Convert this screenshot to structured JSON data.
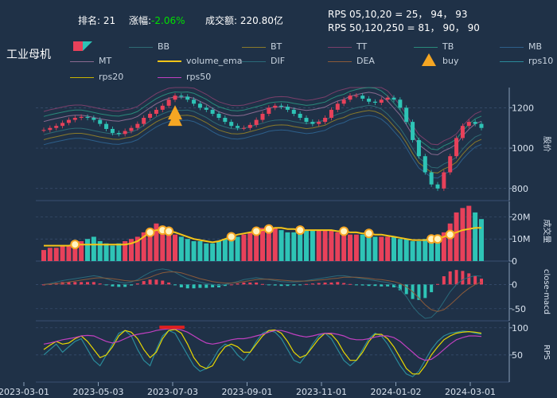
{
  "header": {
    "rank_label": "排名:",
    "rank_value": "21",
    "change_label": "涨幅:",
    "change_value": "-2.06%",
    "turnover_label": "成交额:",
    "turnover_value": "220.80亿",
    "rps_line1": "RPS 05,10,20 = 25， 94， 93",
    "rps_line2": "RPS 50,120,250 = 81， 90， 90",
    "stock_name": "工业母机"
  },
  "legend": [
    {
      "name": "BB",
      "color": "#2f6b74"
    },
    {
      "name": "BT",
      "color": "#8a7a2a"
    },
    {
      "name": "TT",
      "color": "#7a3f6a"
    },
    {
      "name": "TB",
      "color": "#2a8a7a"
    },
    {
      "name": "MB",
      "color": "#2d5f8a"
    },
    {
      "name": "MT",
      "color": "#8a6a90"
    },
    {
      "name": "volume_ema",
      "color": "#f5c518"
    },
    {
      "name": "DIF",
      "color": "#2a6a7a"
    },
    {
      "name": "DEA",
      "color": "#8a5a3a"
    },
    {
      "name": "buy",
      "color": "#f5a623"
    },
    {
      "name": "rps10",
      "color": "#2a8a9a"
    },
    {
      "name": "rps20",
      "color": "#c8b400"
    },
    {
      "name": "rps50",
      "color": "#c040c0"
    }
  ],
  "colors": {
    "up": "#e8415a",
    "down": "#2ec4b6",
    "background": "#1f3147",
    "grid": "#3a5070"
  },
  "chart_data": {
    "type": "candlestick",
    "x_ticks": [
      "2023-03-01",
      "2023-05-03",
      "2023-07-03",
      "2023-09-01",
      "2023-11-01",
      "2024-01-02",
      "2024-03-01"
    ],
    "panels": [
      {
        "id": "price",
        "ylabel": "股价",
        "yticks": [
          800,
          1000,
          1200
        ],
        "ylim": [
          740,
          1300
        ],
        "close": [
          1090,
          1100,
          1110,
          1125,
          1140,
          1150,
          1155,
          1150,
          1140,
          1120,
          1095,
          1075,
          1070,
          1085,
          1100,
          1120,
          1150,
          1170,
          1190,
          1210,
          1240,
          1260,
          1255,
          1240,
          1220,
          1200,
          1190,
          1170,
          1150,
          1130,
          1110,
          1100,
          1100,
          1115,
          1140,
          1170,
          1200,
          1210,
          1205,
          1190,
          1170,
          1150,
          1130,
          1120,
          1130,
          1150,
          1190,
          1220,
          1240,
          1260,
          1260,
          1245,
          1230,
          1225,
          1240,
          1250,
          1240,
          1200,
          1130,
          1040,
          960,
          880,
          820,
          800,
          880,
          960,
          1050,
          1110,
          1130,
          1120,
          1100
        ],
        "buy_markers": [
          21
        ]
      },
      {
        "id": "volume",
        "ylabel": "成交量",
        "yticks": [
          "0",
          "10M",
          "20M"
        ],
        "ylim": [
          0,
          27
        ],
        "values": [
          5,
          6,
          6,
          7,
          7,
          8,
          9,
          10,
          11,
          9,
          8,
          7,
          8,
          9,
          10,
          11,
          13,
          15,
          17,
          16,
          14,
          12,
          11,
          10,
          9,
          9,
          8,
          8,
          9,
          10,
          10,
          11,
          12,
          13,
          14,
          15,
          16,
          15,
          14,
          13,
          13,
          13,
          14,
          14,
          14,
          14,
          14,
          13,
          13,
          12,
          12,
          12,
          12,
          11,
          11,
          11,
          11,
          10,
          10,
          9,
          9,
          10,
          11,
          12,
          13,
          17,
          22,
          24,
          25,
          22,
          19
        ],
        "ema": [
          7,
          7,
          7,
          7,
          7,
          7.5,
          7.5,
          7.5,
          7.5,
          7.5,
          7.5,
          7.5,
          7.5,
          7.5,
          8,
          9,
          11,
          13,
          14,
          14,
          13.5,
          13,
          12,
          11,
          10,
          9.5,
          9,
          8.5,
          9,
          10,
          11,
          12,
          12.5,
          13,
          13.5,
          14,
          14.5,
          15,
          15,
          14.5,
          14.5,
          14,
          14,
          14,
          14,
          14,
          14,
          13.5,
          13.5,
          13,
          13,
          12.5,
          12.5,
          12,
          12,
          11.5,
          11,
          10.5,
          10,
          9.5,
          9.5,
          9.5,
          10,
          10,
          11,
          12,
          13,
          14,
          14.5,
          15,
          15
        ],
        "markers": [
          5,
          17,
          19,
          20,
          30,
          34,
          36,
          41,
          48,
          52,
          62,
          63,
          65
        ]
      },
      {
        "id": "macd",
        "ylabel": "close-macd",
        "yticks": [
          0,
          -50
        ],
        "ylim": [
          -75,
          45
        ],
        "dif": [
          0,
          2,
          5,
          8,
          10,
          12,
          14,
          16,
          18,
          16,
          12,
          8,
          5,
          3,
          5,
          10,
          18,
          25,
          30,
          32,
          30,
          25,
          18,
          12,
          8,
          5,
          2,
          0,
          -2,
          0,
          3,
          6,
          10,
          12,
          14,
          12,
          10,
          8,
          6,
          5,
          5,
          6,
          8,
          10,
          12,
          14,
          16,
          18,
          18,
          16,
          14,
          12,
          10,
          8,
          6,
          4,
          0,
          -10,
          -25,
          -45,
          -60,
          -70,
          -68,
          -55,
          -35,
          -15,
          0,
          10,
          15,
          18,
          17
        ],
        "dea": [
          0,
          1,
          2,
          3,
          5,
          7,
          9,
          11,
          13,
          14,
          13,
          12,
          10,
          8,
          7,
          8,
          11,
          15,
          20,
          24,
          26,
          26,
          24,
          20,
          16,
          12,
          9,
          6,
          4,
          3,
          3,
          4,
          6,
          8,
          10,
          11,
          11,
          10,
          9,
          8,
          7,
          7,
          7,
          8,
          9,
          10,
          12,
          13,
          15,
          15,
          15,
          14,
          13,
          11,
          10,
          8,
          6,
          2,
          -5,
          -15,
          -28,
          -42,
          -52,
          -56,
          -52,
          -42,
          -30,
          -18,
          -8,
          0,
          5
        ]
      },
      {
        "id": "rps",
        "ylabel": "RPS",
        "yticks": [
          50,
          100
        ],
        "ylim": [
          0,
          110
        ],
        "rps10": [
          50,
          60,
          70,
          55,
          65,
          75,
          80,
          60,
          40,
          30,
          50,
          70,
          90,
          95,
          85,
          60,
          40,
          30,
          60,
          85,
          95,
          90,
          70,
          50,
          30,
          20,
          25,
          40,
          60,
          70,
          65,
          50,
          40,
          55,
          75,
          90,
          95,
          92,
          80,
          60,
          40,
          35,
          50,
          70,
          85,
          90,
          80,
          60,
          40,
          30,
          40,
          60,
          80,
          90,
          85,
          70,
          50,
          30,
          15,
          10,
          20,
          40,
          60,
          75,
          85,
          90,
          92,
          94,
          93,
          90,
          88
        ],
        "rps20": [
          60,
          68,
          75,
          70,
          72,
          80,
          85,
          75,
          60,
          45,
          50,
          65,
          85,
          95,
          92,
          80,
          60,
          45,
          55,
          80,
          95,
          97,
          90,
          70,
          45,
          30,
          25,
          30,
          50,
          65,
          70,
          65,
          55,
          55,
          70,
          85,
          95,
          96,
          90,
          75,
          55,
          45,
          50,
          65,
          80,
          90,
          88,
          75,
          55,
          40,
          40,
          55,
          75,
          88,
          88,
          80,
          65,
          45,
          25,
          15,
          15,
          30,
          50,
          65,
          78,
          85,
          90,
          92,
          93,
          92,
          90
        ],
        "rps50": [
          70,
          72,
          75,
          78,
          80,
          82,
          85,
          86,
          85,
          80,
          75,
          72,
          75,
          80,
          85,
          88,
          90,
          92,
          95,
          97,
          98,
          98,
          96,
          92,
          85,
          78,
          72,
          70,
          72,
          75,
          78,
          80,
          80,
          82,
          85,
          88,
          92,
          95,
          95,
          92,
          88,
          85,
          83,
          85,
          88,
          90,
          90,
          88,
          85,
          80,
          78,
          78,
          80,
          83,
          85,
          85,
          82,
          75,
          65,
          55,
          45,
          40,
          42,
          50,
          60,
          70,
          78,
          82,
          85,
          85,
          84
        ]
      }
    ]
  }
}
